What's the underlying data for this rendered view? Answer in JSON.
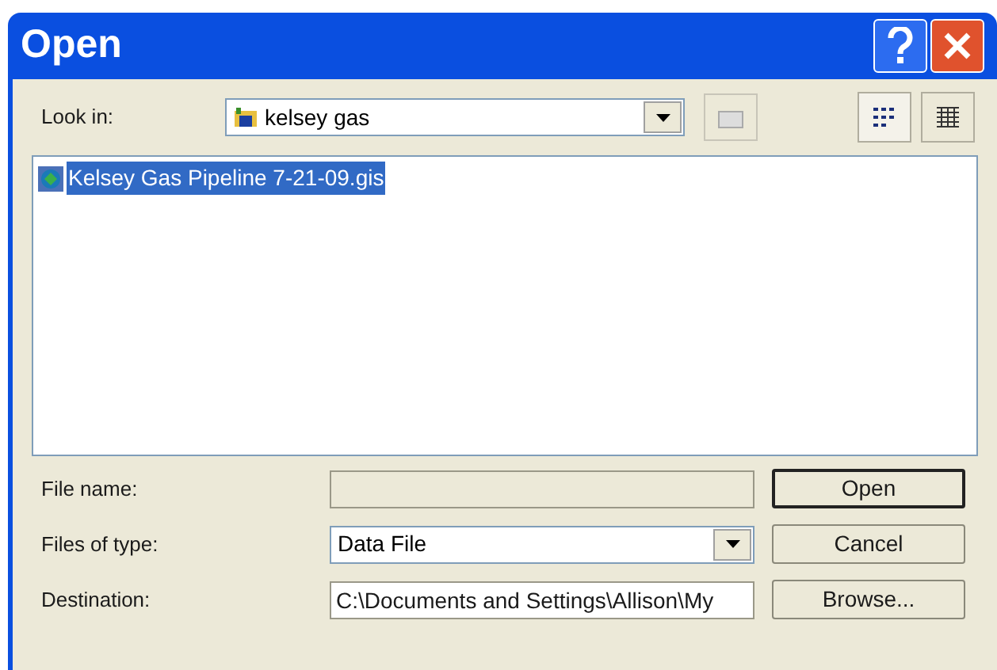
{
  "window": {
    "title": "Open"
  },
  "look_in": {
    "label": "Look in:",
    "value": "kelsey gas"
  },
  "files": [
    {
      "name": "Kelsey Gas Pipeline 7-21-09.gis",
      "selected": true
    }
  ],
  "fields": [
    {
      "kind": "text",
      "label": "File name:",
      "disabled": true,
      "button": "Open"
    },
    {
      "kind": "dropdown",
      "label": "Files of type:",
      "value": "Data File",
      "disabled": false,
      "button": "Cancel"
    },
    {
      "kind": "text",
      "label": "Destination:",
      "value": "C:\\Documents and Settings\\Allison\\My",
      "disabled": false,
      "button": "Browse..."
    }
  ]
}
